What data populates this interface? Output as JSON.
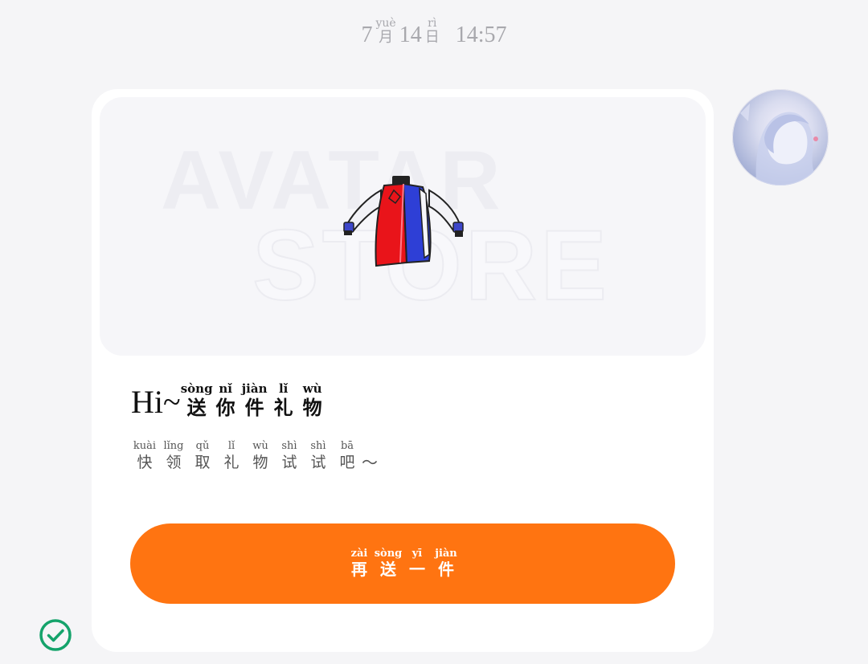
{
  "timestamp": {
    "month": "7",
    "month_char": "月",
    "month_pinyin": "yuè",
    "day": "14",
    "day_char": "日",
    "day_pinyin": "rì",
    "time": "14:57"
  },
  "card": {
    "banner": {
      "watermark_line1": "AVATAR",
      "watermark_line2": "STORE",
      "image_icon": "jacket-icon"
    },
    "title": {
      "prefix": "Hi~",
      "chars": [
        {
          "py": "sòng",
          "hz": "送"
        },
        {
          "py": "nǐ",
          "hz": "你"
        },
        {
          "py": "jiàn",
          "hz": "件"
        },
        {
          "py": "lǐ",
          "hz": "礼"
        },
        {
          "py": "wù",
          "hz": "物"
        }
      ]
    },
    "subtitle": {
      "chars": [
        {
          "py": "kuài",
          "hz": "快"
        },
        {
          "py": "lǐng",
          "hz": "领"
        },
        {
          "py": "qǔ",
          "hz": "取"
        },
        {
          "py": "lǐ",
          "hz": "礼"
        },
        {
          "py": "wù",
          "hz": "物"
        },
        {
          "py": "shì",
          "hz": "试"
        },
        {
          "py": "shì",
          "hz": "试"
        },
        {
          "py": "bā",
          "hz": "吧"
        }
      ],
      "suffix": "～"
    },
    "button": {
      "chars": [
        {
          "py": "zài",
          "hz": "再"
        },
        {
          "py": "sòng",
          "hz": "送"
        },
        {
          "py": "yī",
          "hz": "一"
        },
        {
          "py": "jiàn",
          "hz": "件"
        }
      ],
      "color": "#ff7411"
    }
  },
  "avatar": {
    "icon": "user-avatar"
  },
  "status": {
    "icon": "check-circle-icon",
    "color": "#15a36b"
  }
}
